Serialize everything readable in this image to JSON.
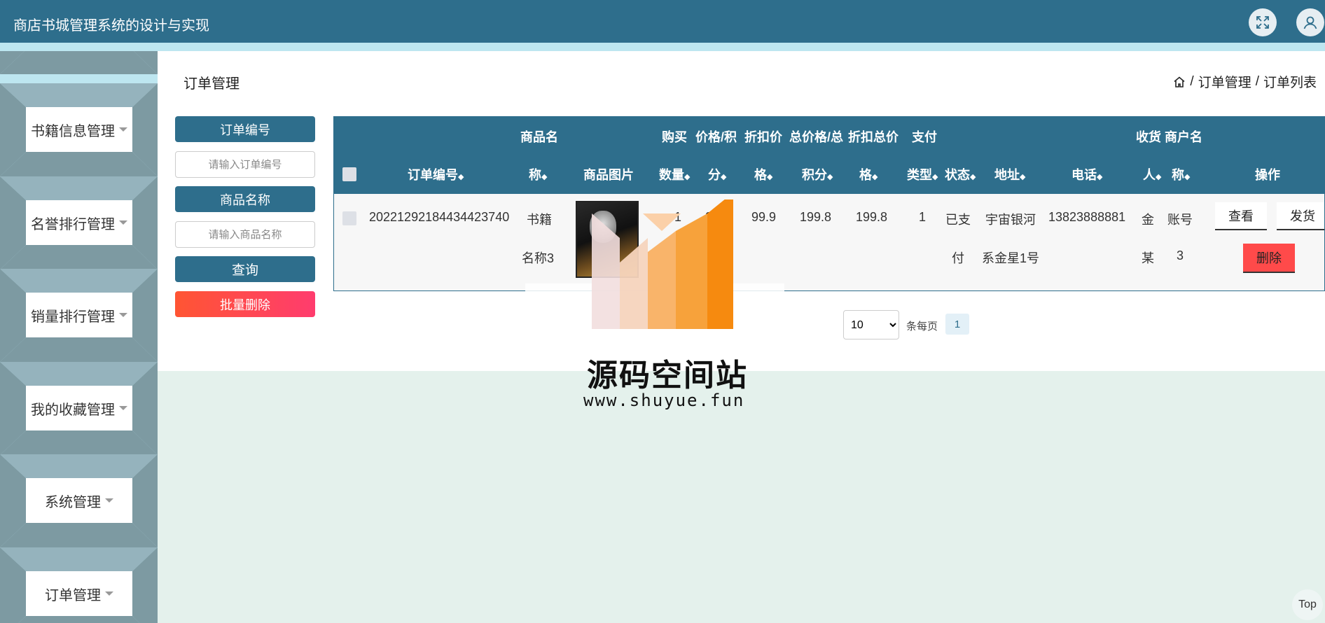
{
  "app": {
    "title": "商店书城管理系统的设计与实现"
  },
  "header": {
    "expand_icon": "expand-icon",
    "user_icon": "user-icon"
  },
  "sidebar": {
    "items": [
      {
        "label": "书籍信息管理"
      },
      {
        "label": "名誉排行管理"
      },
      {
        "label": "销量排行管理"
      },
      {
        "label": "我的收藏管理"
      },
      {
        "label": "系统管理"
      },
      {
        "label": "订单管理"
      }
    ]
  },
  "page": {
    "title": "订单管理",
    "breadcrumb": [
      "订单管理",
      "订单列表"
    ]
  },
  "search": {
    "order_no_label": "订单编号",
    "order_no_placeholder": "请输入订单编号",
    "product_name_label": "商品名称",
    "product_name_placeholder": "请输入商品名称",
    "query_button": "查询",
    "batch_delete_button": "批量删除"
  },
  "table": {
    "headers": {
      "order_no": "订单编号",
      "product_name_1": "商品名",
      "product_name_2": "称",
      "product_image": "商品图片",
      "qty_1": "购买",
      "qty_2": "数量",
      "price_1": "价格/积",
      "price_2": "分",
      "discount_price_1": "折扣价",
      "discount_price_2": "格",
      "total_1": "总价格/总",
      "total_2": "积分",
      "discount_total_1": "折扣总价",
      "discount_total_2": "格",
      "pay_1": "支付",
      "pay_2": "类型",
      "status": "状态",
      "address": "地址",
      "phone": "电话",
      "receiver_1": "收货",
      "receiver_2": "人",
      "merchant_1": "商户名",
      "merchant_2": "称",
      "actions": "操作"
    },
    "row": {
      "order_no": "20221292184434423740",
      "product_name_1": "书籍",
      "product_name_2": "名称3",
      "qty": "1",
      "price": "99.9",
      "discount_price": "99.9",
      "total": "199.8",
      "discount_total": "199.8",
      "pay_type": "1",
      "status_1": "已支",
      "status_2": "付",
      "address_1": "宇宙银河",
      "address_2": "系金星1号",
      "phone": "13823888881",
      "receiver_1": "金",
      "receiver_2": "某",
      "merchant_1": "账号",
      "merchant_2": "3",
      "view_button": "查看",
      "ship_button": "发货",
      "delete_button": "删除"
    }
  },
  "pagination": {
    "page_size": "10",
    "per_page_label": "条每页",
    "current_page": "1"
  },
  "watermark": {
    "title": "源码空间站",
    "url": "www.shuyue.fun"
  },
  "footer": {
    "top_label": "Top"
  }
}
